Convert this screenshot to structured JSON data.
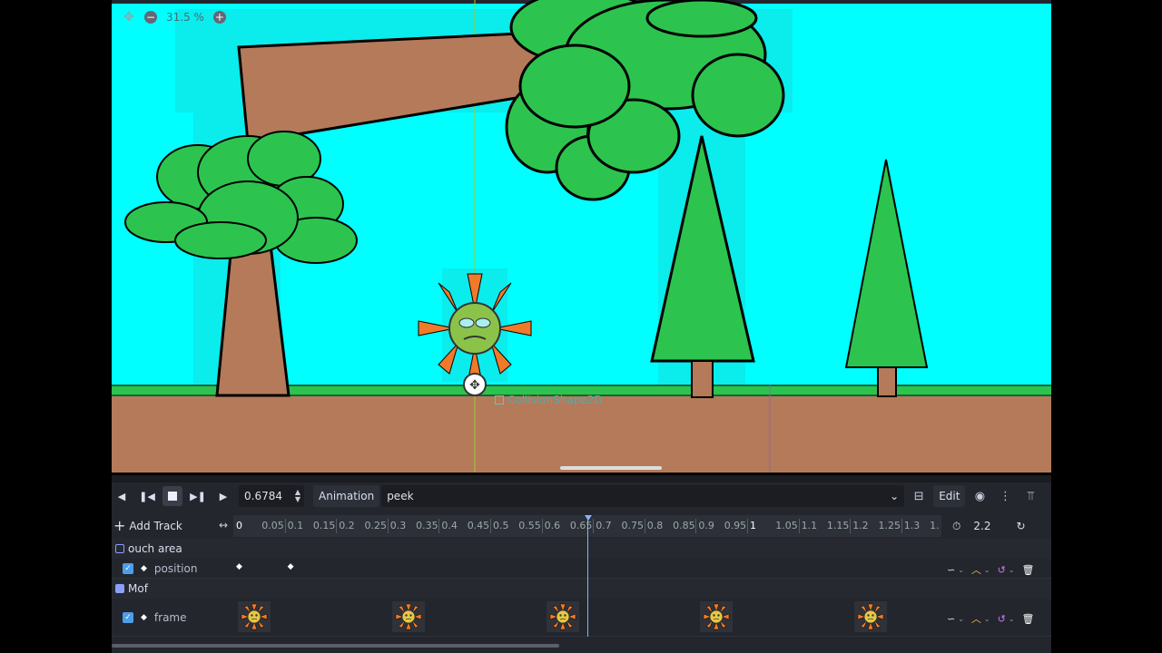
{
  "viewport": {
    "zoom_text": "31.5 %",
    "zoom_out_icon": "minus-icon",
    "zoom_in_icon": "plus-icon",
    "pan_icon": "move-icon",
    "collision_label": "CollisionShape2D",
    "sky_color": "#00ffff",
    "grass_color": "#2cc44e",
    "ground_color": "#b47a5a"
  },
  "toolbar": {
    "time_value": "0.6784",
    "animation_label": "Animation",
    "animation_selected": "peek",
    "edit_label": "Edit"
  },
  "timeline": {
    "add_track_label": "Add Track",
    "ticks": [
      "0",
      "0.05",
      "0.1",
      "0.15",
      "0.2",
      "0.25",
      "0.3",
      "0.35",
      "0.4",
      "0.45",
      "0.5",
      "0.55",
      "0.6",
      "0.65",
      "0.7",
      "0.75",
      "0.8",
      "0.85",
      "0.9",
      "0.95",
      "1",
      "1.05",
      "1.1",
      "1.15",
      "1.2",
      "1.25",
      "1.3",
      "1."
    ],
    "length_value": "2.2",
    "playhead_time": 0.6784
  },
  "tracks": [
    {
      "node": "ouch area",
      "property": "position",
      "key_times": [
        0,
        0.1
      ]
    },
    {
      "node": "Mof",
      "property": "frame",
      "key_times": [
        0.03,
        0.33,
        0.63,
        0.93,
        1.23
      ]
    }
  ]
}
